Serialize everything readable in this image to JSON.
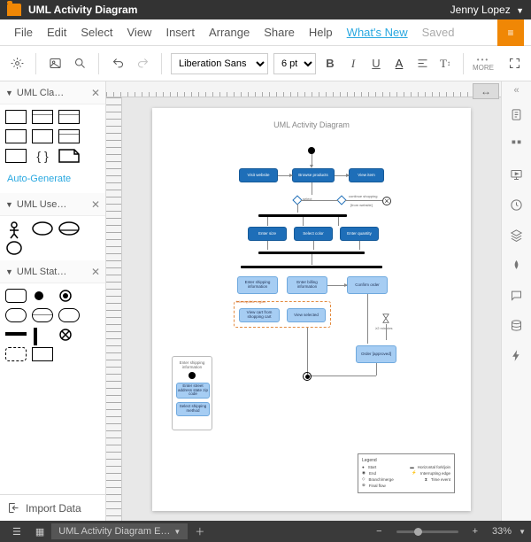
{
  "header": {
    "doc_title": "UML Activity Diagram",
    "user_name": "Jenny Lopez"
  },
  "menu": {
    "items": [
      "File",
      "Edit",
      "Select",
      "View",
      "Insert",
      "Arrange",
      "Share",
      "Help"
    ],
    "whats_new": "What's New",
    "saved": "Saved"
  },
  "toolbar": {
    "font_name": "Liberation Sans",
    "font_size": "6 pt",
    "more_label": "MORE"
  },
  "left_panels": {
    "p1": "UML Cla…",
    "p2": "UML Use…",
    "p3": "UML Stat…",
    "auto_generate": "Auto-Generate",
    "import": "Import Data"
  },
  "diagram": {
    "title": "UML Activity Diagram",
    "nodes": {
      "visit_website": "Visit website",
      "browse_products": "Browse products",
      "view_item": "View item",
      "select_label": "select",
      "continue_shopping": "continue shopping",
      "from_website": "[from website]",
      "enter_size": "Enter size",
      "select_color": "Select color",
      "enter_quantity": "Enter quantity",
      "enter_shipping": "Enter shipping information",
      "enter_billing": "Enter billing information",
      "confirm_order": "Confirm order",
      "interruptible": "Interruptible region",
      "view_cart": "View cart from shopping cart",
      "view_selected": "View selected",
      "two_mins": "≥2 minutes",
      "order_approved": "Order [approved]"
    },
    "sidebox": {
      "title": "Enter shipping information",
      "enter_address": "Enter street address state zip code",
      "select_shipping": "Select shipping method"
    },
    "legend": {
      "title": "Legend",
      "rows": [
        {
          "l": "Start",
          "r": "Horizontal fork/join"
        },
        {
          "l": "End",
          "r": "Interrupting edge"
        },
        {
          "l": "Branch/merge",
          "r": "Time event"
        },
        {
          "l": "Final flow",
          "r": ""
        }
      ]
    }
  },
  "status": {
    "doc_tab": "UML Activity Diagram E…",
    "zoom": "33%"
  }
}
